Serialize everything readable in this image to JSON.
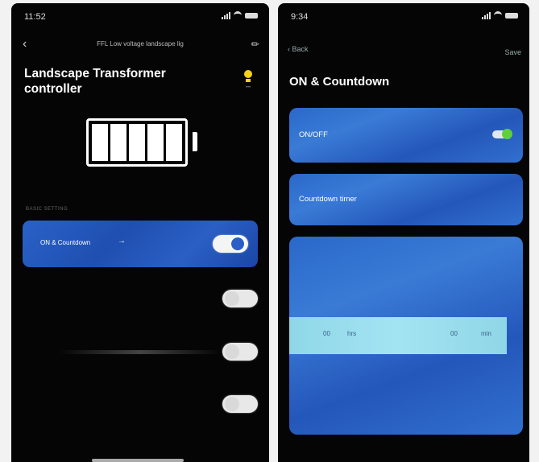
{
  "left_screen": {
    "status": {
      "time": "11:52"
    },
    "nav": {
      "back_icon": "chevron-left-icon",
      "title": "FFL Low voltage landscape lig",
      "edit_icon": "pencil-icon"
    },
    "device_title": "Landscape Transformer controller",
    "light_icon": "light-bulb-icon",
    "light_icon_color": "#f5d020",
    "section_label": "BASIC SETTING",
    "rows": [
      {
        "label": "ON & Countdown",
        "toggle_on": true
      }
    ],
    "toggles_off": 3
  },
  "right_screen": {
    "status": {
      "time": "9:34"
    },
    "nav": {
      "back_label": "Back",
      "save_label": "Save"
    },
    "page_title": "ON & Countdown",
    "onoff_label": "ON/OFF",
    "onoff_on": true,
    "onoff_knob_color": "#5ed13a",
    "countdown_label": "Countdown timer",
    "picker": {
      "col1": "00",
      "col2": "hrs",
      "col3": "00",
      "col4": "min"
    }
  },
  "colors": {
    "card_blue": "#2a62c8",
    "background": "#050505"
  }
}
